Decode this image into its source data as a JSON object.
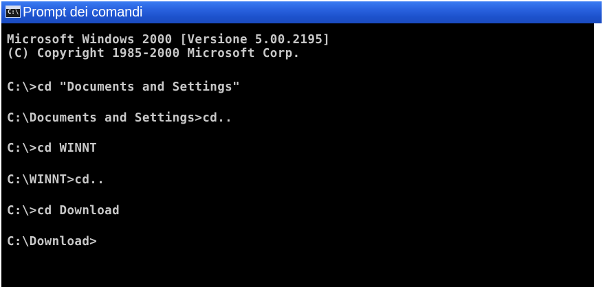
{
  "window": {
    "title": "Prompt dei comandi",
    "icon": "console-icon",
    "icon_glyph": "C:\\"
  },
  "console": {
    "lines": [
      "Microsoft Windows 2000 [Versione 5.00.2195]",
      "(C) Copyright 1985-2000 Microsoft Corp.",
      "C:\\>cd \"Documents and Settings\"",
      "C:\\Documents and Settings>cd..",
      "C:\\>cd WINNT",
      "C:\\WINNT>cd..",
      "C:\\>cd Download",
      "C:\\Download>"
    ]
  },
  "colors": {
    "titlebar": "#2a63e0",
    "console_bg": "#000000",
    "console_text": "#c8c8c8"
  }
}
